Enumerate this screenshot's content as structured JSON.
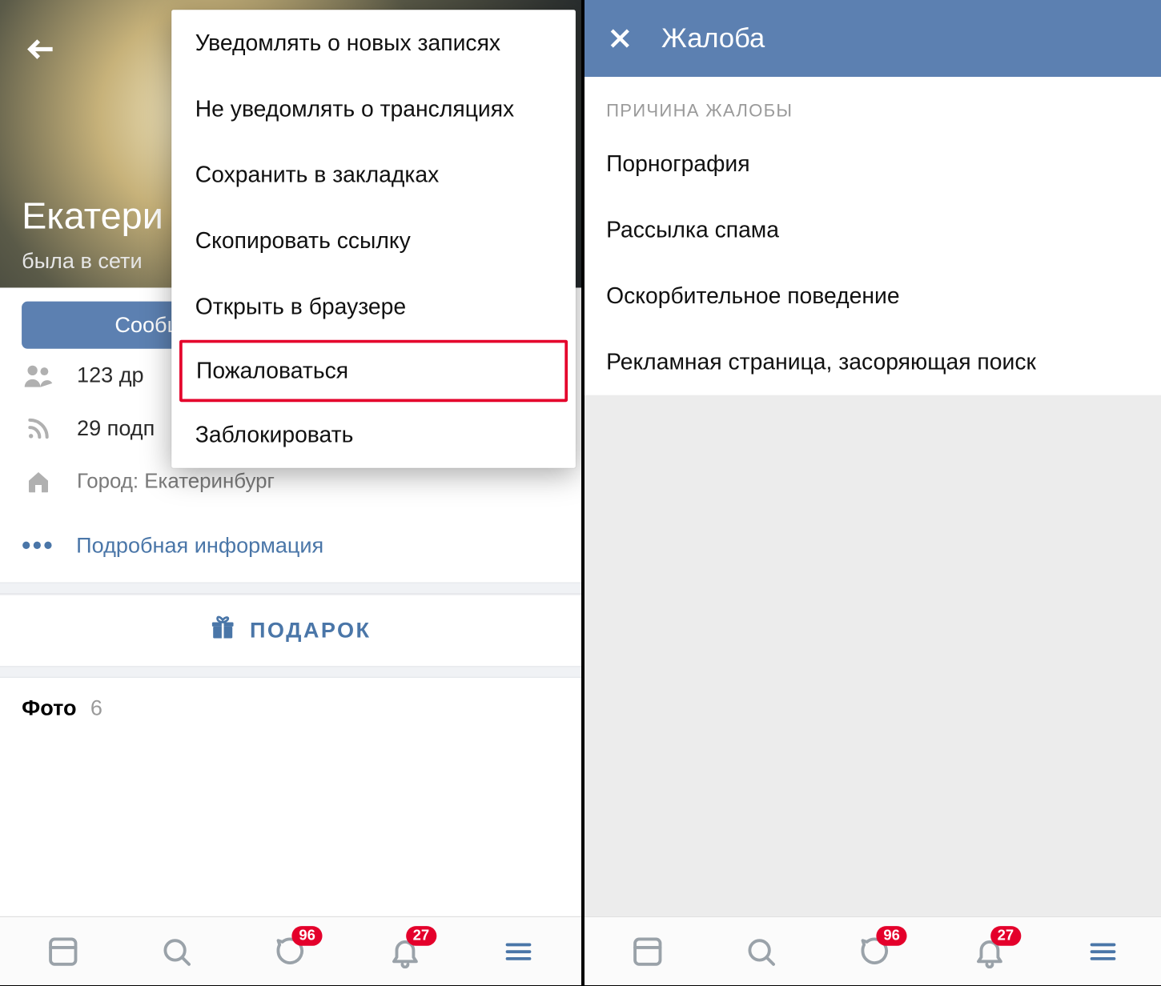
{
  "left": {
    "profile_name": "Екатери",
    "profile_status": "была в сети",
    "message_button": "Сообщ",
    "friends_line": "123 др",
    "followers_line": "29 подп",
    "city_line": "Город: Екатеринбург",
    "details_link": "Подробная информация",
    "gift_label": "ПОДАРОК",
    "photos_label": "Фото",
    "photos_count": "6",
    "menu": {
      "items": [
        "Уведомлять о новых записях",
        "Не уведомлять о трансляциях",
        "Сохранить в закладках",
        "Скопировать ссылку",
        "Открыть в браузере",
        "Пожаловаться",
        "Заблокировать"
      ],
      "highlight_index": 5
    }
  },
  "right": {
    "title": "Жалоба",
    "section_label": "ПРИЧИНА ЖАЛОБЫ",
    "reasons": [
      "Порнография",
      "Рассылка спама",
      "Оскорбительное поведение",
      "Рекламная страница, засоряющая поиск"
    ]
  },
  "nav": {
    "badge_messages": "96",
    "badge_notifications": "27"
  }
}
